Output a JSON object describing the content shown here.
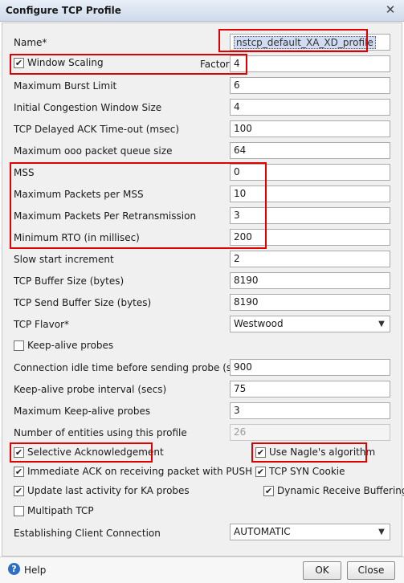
{
  "window": {
    "title": "Configure TCP Profile",
    "close_glyph": "✕"
  },
  "fields": {
    "name": {
      "label": "Name*",
      "value": "nstcp_default_XA_XD_profile"
    },
    "window_scaling": {
      "label": "Window Scaling",
      "checked": true,
      "factor_label": "Factor",
      "factor_value": "4"
    },
    "max_burst": {
      "label": "Maximum Burst Limit",
      "value": "6"
    },
    "init_cwnd": {
      "label": "Initial Congestion Window Size",
      "value": "4"
    },
    "delayed_ack": {
      "label": "TCP Delayed ACK Time-out (msec)",
      "value": "100"
    },
    "ooo_queue": {
      "label": "Maximum ooo packet queue size",
      "value": "64"
    },
    "mss": {
      "label": "MSS",
      "value": "0"
    },
    "max_pkt_mss": {
      "label": "Maximum Packets per MSS",
      "value": "10"
    },
    "max_pkt_retx": {
      "label": "Maximum Packets Per Retransmission",
      "value": "3"
    },
    "min_rto": {
      "label": "Minimum RTO (in millisec)",
      "value": "200"
    },
    "slow_start": {
      "label": "Slow start increment",
      "value": "2"
    },
    "buffer_size": {
      "label": "TCP Buffer Size (bytes)",
      "value": "8190"
    },
    "send_buffer": {
      "label": "TCP Send Buffer Size (bytes)",
      "value": "8190"
    },
    "flavor": {
      "label": "TCP Flavor*",
      "value": "Westwood"
    },
    "keepalive": {
      "label": "Keep-alive probes",
      "checked": false
    },
    "idle_time": {
      "label": "Connection idle time before sending probe (secs)",
      "value": "900"
    },
    "ka_interval": {
      "label": "Keep-alive probe interval (secs)",
      "value": "75"
    },
    "max_ka": {
      "label": "Maximum Keep-alive probes",
      "value": "3"
    },
    "num_entities": {
      "label": "Number of entities using this profile",
      "value": "26"
    },
    "establishing": {
      "label": "Establishing Client Connection",
      "value": "AUTOMATIC"
    }
  },
  "checkboxes": {
    "sack": {
      "label": "Selective Acknowledgement",
      "checked": true
    },
    "nagle": {
      "label": "Use Nagle's algorithm",
      "checked": true
    },
    "immediate_ack": {
      "label": "Immediate ACK on receiving packet with PUSH",
      "checked": true
    },
    "syn_cookie": {
      "label": "TCP SYN Cookie",
      "checked": true
    },
    "update_ka": {
      "label": "Update last activity for KA probes",
      "checked": true
    },
    "dyn_buffering": {
      "label": "Dynamic Receive Buffering",
      "checked": true
    },
    "multipath": {
      "label": "Multipath TCP",
      "checked": false
    }
  },
  "footer": {
    "help_label": "Help",
    "ok_label": "OK",
    "close_label": "Close"
  },
  "icons": {
    "check": "✔",
    "dropdown": "▼",
    "help": "?"
  },
  "colors": {
    "highlight": "#e10000",
    "help_icon": "#2f6fc2"
  }
}
